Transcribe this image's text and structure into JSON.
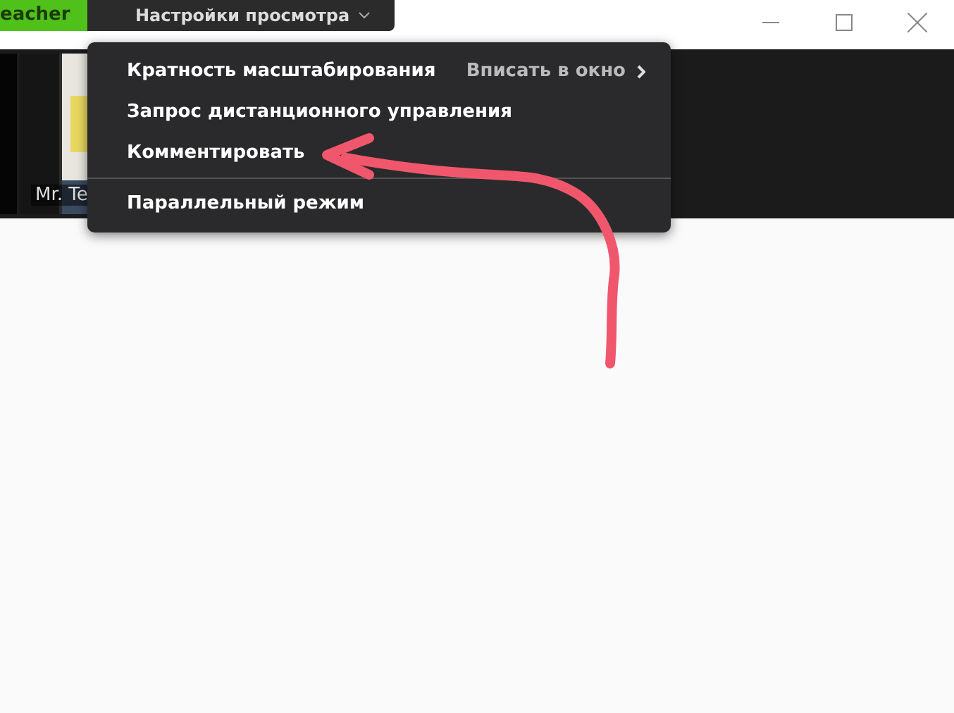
{
  "top_bar": {
    "tab": "eacher",
    "menu_button": "Настройки просмотра"
  },
  "video": {
    "name": "Mr. Te"
  },
  "menu": {
    "items": [
      {
        "label": "Кратность масштабирования",
        "value": "Вписать в окно",
        "submenu": true,
        "divider_before": false
      },
      {
        "label": "Запрос дистанционного управления",
        "submenu": false,
        "divider_before": false
      },
      {
        "label": "Комментировать",
        "submenu": false,
        "divider_before": false
      },
      {
        "label": "Параллельный режим",
        "submenu": false,
        "divider_before": true
      }
    ]
  }
}
